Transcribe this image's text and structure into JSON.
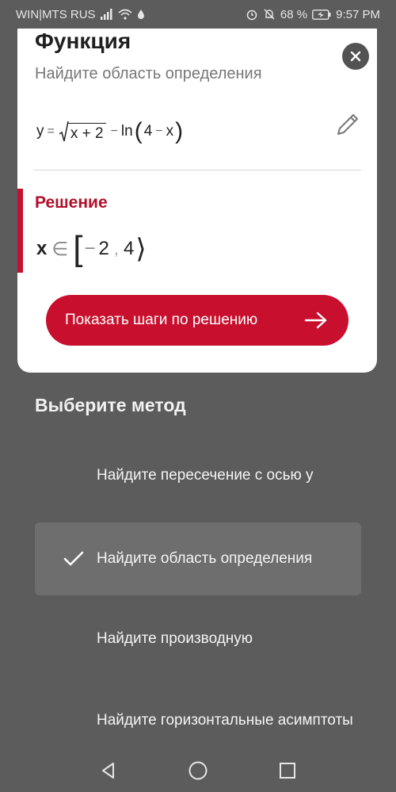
{
  "status_bar": {
    "carrier": "WIN|MTS RUS",
    "battery": "68 %",
    "time": "9:57 PM",
    "icons": [
      "sim-icon",
      "signal-icon",
      "wifi-icon",
      "data-drop-icon",
      "alarm-icon",
      "mute-icon",
      "battery-icon"
    ]
  },
  "card": {
    "title": "Функция",
    "subtitle": "Найдите область определения",
    "formula": {
      "lhs": "y",
      "eq": "=",
      "radicand": "x + 2",
      "minus": "−",
      "ln": "ln",
      "arg_a": "4",
      "arg_op": "−",
      "arg_b": "x"
    },
    "solution_heading": "Решение",
    "answer": {
      "var": "x",
      "elem": "∈",
      "open": "[",
      "sign": "−",
      "low": "2",
      "comma": ",",
      "high": "4",
      "close": "⟩"
    },
    "steps_button": "Показать шаги по решению"
  },
  "methods": {
    "title": "Выберите метод",
    "items": [
      {
        "label": "Найдите пересечение с осью y",
        "selected": false
      },
      {
        "label": "Найдите область определения",
        "selected": true
      },
      {
        "label": "Найдите производную",
        "selected": false
      },
      {
        "label": "Найдите горизонтальные асимптоты",
        "selected": false
      }
    ]
  },
  "nav": [
    "back-icon",
    "home-icon",
    "recents-icon"
  ],
  "colors": {
    "accent": "#c8102e",
    "overlay": "#5c5c5c",
    "selected_row": "#6e6e6e"
  }
}
